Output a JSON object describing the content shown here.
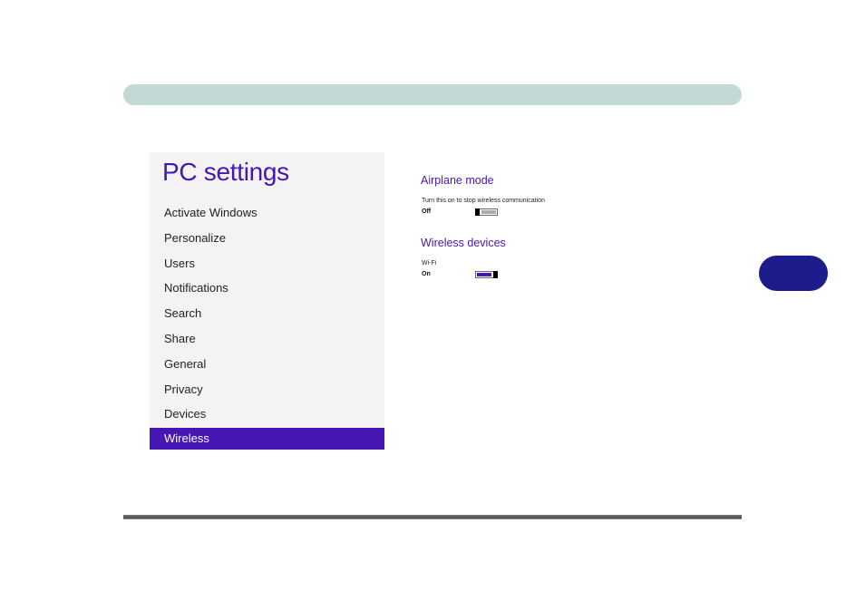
{
  "pc_settings": {
    "title": "PC settings",
    "nav_items": [
      {
        "label": "Activate Windows"
      },
      {
        "label": "Personalize"
      },
      {
        "label": "Users"
      },
      {
        "label": "Notifications"
      },
      {
        "label": "Search"
      },
      {
        "label": "Share"
      },
      {
        "label": "General"
      },
      {
        "label": "Privacy"
      },
      {
        "label": "Devices"
      },
      {
        "label": "Wireless",
        "selected": true
      }
    ],
    "airplane_mode": {
      "title": "Airplane mode",
      "description": "Turn this on to stop wireless communication",
      "state": "Off"
    },
    "wireless_devices": {
      "title": "Wireless devices",
      "wifi_label": "Wi-Fi",
      "wifi_state": "On"
    }
  },
  "colors": {
    "accent": "#4617b4",
    "header_bar": "#c2d9d6",
    "side_tab": "#1c1c8c",
    "nav_background": "#f3f3f3"
  }
}
